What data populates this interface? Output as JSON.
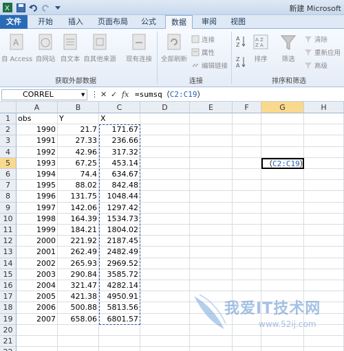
{
  "titlebar": {
    "app_title": "新建 Microsoft"
  },
  "tabs": [
    "文件",
    "开始",
    "插入",
    "页面布局",
    "公式",
    "数据",
    "审阅",
    "视图"
  ],
  "ribbon": {
    "get_external": {
      "buttons": [
        "自 Access",
        "自网站",
        "自文本",
        "自其他来源",
        "现有连接"
      ],
      "label": "获取外部数据"
    },
    "connections": {
      "refresh_all": "全部刷新",
      "small": [
        "连接",
        "属性",
        "编辑链接"
      ],
      "label": "连接"
    },
    "sort_filter": {
      "sort": "排序",
      "filter": "筛选",
      "small": [
        "清除",
        "重新应用",
        "高级"
      ],
      "label": "排序和筛选"
    }
  },
  "formula_bar": {
    "name_box": "CORREL",
    "formula_prefix": "=sumsq（",
    "formula_ref": "C2:C19",
    "formula_suffix": "）"
  },
  "columns": [
    "A",
    "B",
    "C",
    "D",
    "E",
    "F",
    "G",
    "H"
  ],
  "rows": [
    "1",
    "2",
    "3",
    "4",
    "5",
    "6",
    "7",
    "8",
    "9",
    "10",
    "11",
    "12",
    "13",
    "14",
    "15",
    "16",
    "17",
    "18",
    "19",
    "20",
    "21",
    "22"
  ],
  "headers": {
    "a": "obs",
    "b": "Y",
    "c": "X"
  },
  "table": [
    [
      "1990",
      "21.7",
      "171.67"
    ],
    [
      "1991",
      "27.33",
      "236.66"
    ],
    [
      "1992",
      "42.96",
      "317.32"
    ],
    [
      "1993",
      "67.25",
      "453.14"
    ],
    [
      "1994",
      "74.4",
      "634.67"
    ],
    [
      "1995",
      "88.02",
      "842.48"
    ],
    [
      "1996",
      "131.75",
      "1048.44"
    ],
    [
      "1997",
      "142.06",
      "1297.42"
    ],
    [
      "1998",
      "164.39",
      "1534.73"
    ],
    [
      "1999",
      "184.21",
      "1804.02"
    ],
    [
      "2000",
      "221.92",
      "2187.45"
    ],
    [
      "2001",
      "262.49",
      "2482.49"
    ],
    [
      "2002",
      "265.93",
      "2969.52"
    ],
    [
      "2003",
      "290.84",
      "3585.72"
    ],
    [
      "2004",
      "321.47",
      "4282.14"
    ],
    [
      "2005",
      "421.38",
      "4950.91"
    ],
    [
      "2006",
      "500.88",
      "5813.56"
    ],
    [
      "2007",
      "658.06",
      "6801.57"
    ]
  ],
  "active_cell": {
    "prefix": "（",
    "ref": "C2:C19",
    "suffix": "）"
  },
  "watermark": {
    "text": "我爱IT技术网",
    "url": "www.52ij.com"
  }
}
